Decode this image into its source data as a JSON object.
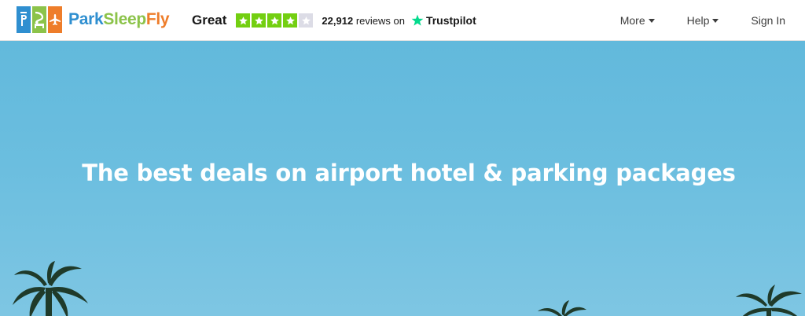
{
  "brand": {
    "name_part1": "Park",
    "name_part2": "Sleep",
    "name_part3": "Fly",
    "colors": {
      "park": "#2f8fd0",
      "sleep": "#8cc34a",
      "fly": "#ee7d2a"
    },
    "tile_icons": [
      "parking-p-icon",
      "bed-icon",
      "plane-icon"
    ]
  },
  "trustpilot": {
    "rating_label": "Great",
    "stars_filled": 4,
    "stars_total": 5,
    "review_count": "22,912",
    "reviews_text": "reviews on",
    "brand": "Trustpilot",
    "star_color": "#73cf11",
    "empty_star_color": "#dcdce6"
  },
  "nav": {
    "more_label": "More",
    "help_label": "Help",
    "signin_label": "Sign In"
  },
  "hero": {
    "headline": "The best deals on airport hotel & parking packages"
  }
}
